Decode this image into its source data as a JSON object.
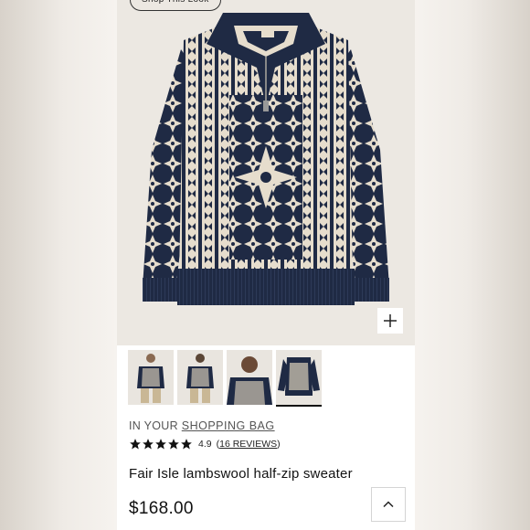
{
  "hero": {
    "shop_look_label": "Shop This Look",
    "zoom_icon": "plus-icon"
  },
  "thumbnails": [
    {
      "name": "model-front-view",
      "active": false
    },
    {
      "name": "model-back-view",
      "active": false
    },
    {
      "name": "model-closeup-view",
      "active": false
    },
    {
      "name": "flat-lay-view",
      "active": true
    }
  ],
  "bag": {
    "prefix": "IN YOUR",
    "link_label": "SHOPPING BAG"
  },
  "rating": {
    "stars": 5,
    "value": "4.9",
    "reviews_label": "16 REVIEWS",
    "open_paren": "(",
    "close_paren": ")"
  },
  "product": {
    "title": "Fair Isle lambswool half-zip sweater",
    "price": "$168.00"
  },
  "colors": {
    "navy": "#1f2a44",
    "cream": "#e6ddcd",
    "hero_bg": "#ece8e2"
  },
  "icons": {
    "zoom": "plus-icon",
    "scroll_up": "chevron-up-icon",
    "star": "star-icon"
  }
}
